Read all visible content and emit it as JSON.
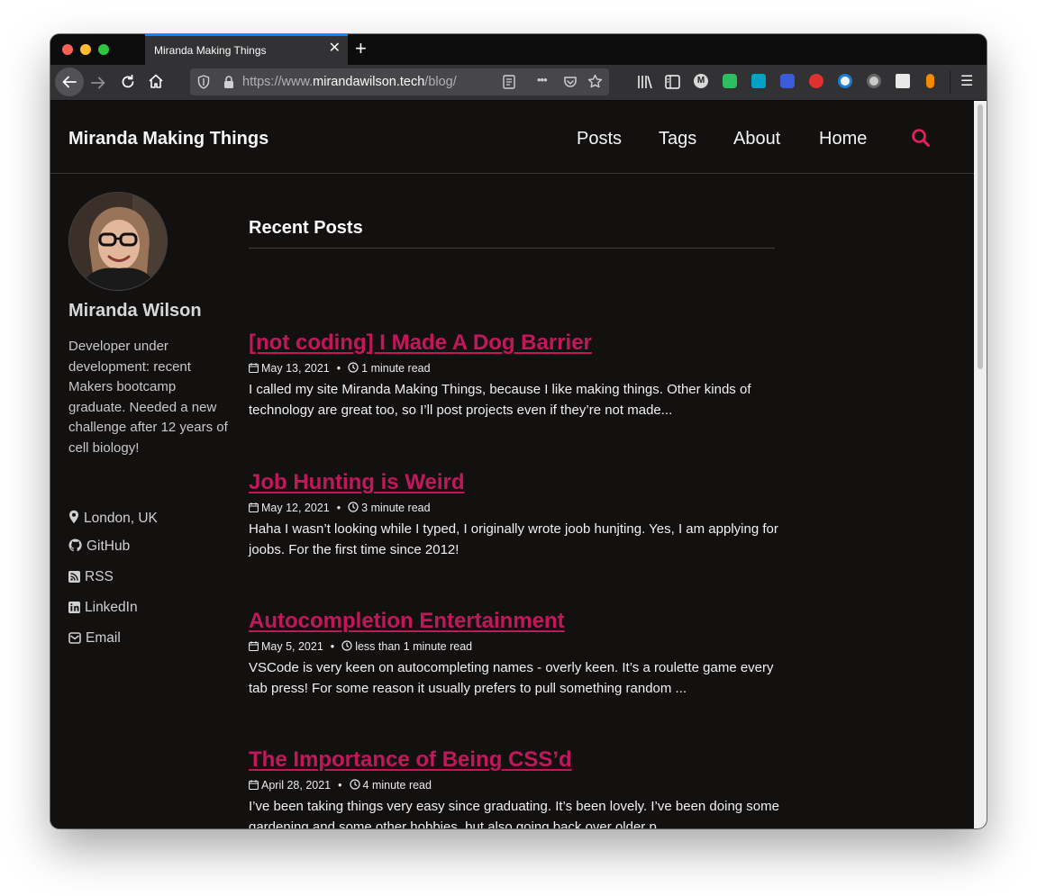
{
  "browser": {
    "tab_title": "Miranda Making Things",
    "tab_close": "✕",
    "new_tab": "+",
    "url_prefix": "https://www.",
    "url_domain": "mirandawilson.tech",
    "url_path": "/blog/",
    "page_actions": "•••",
    "menu": "☰"
  },
  "site": {
    "title": "Miranda Making Things",
    "nav": [
      "Posts",
      "Tags",
      "About",
      "Home"
    ],
    "accent_color": "#e91e63"
  },
  "author": {
    "name": "Miranda Wilson",
    "bio": "Developer under development: recent Makers bootcamp graduate. Needed a new challenge after 12 years of cell biology!",
    "links": [
      {
        "icon": "location-pin-icon",
        "label": "London, UK"
      },
      {
        "icon": "github-icon",
        "label": "GitHub"
      },
      {
        "icon": "rss-icon",
        "label": "RSS"
      },
      {
        "icon": "linkedin-icon",
        "label": "LinkedIn"
      },
      {
        "icon": "email-icon",
        "label": "Email"
      }
    ]
  },
  "main": {
    "section_title": "Recent Posts",
    "posts": [
      {
        "title": "[not coding] I Made A Dog Barrier",
        "date": "May 13, 2021",
        "read_time": "1 minute read",
        "excerpt": "I called my site Miranda Making Things, because I like making things. Other kinds of technology are great too, so I’ll post projects even if they’re not made..."
      },
      {
        "title": "Job Hunting is Weird",
        "date": "May 12, 2021",
        "read_time": "3 minute read",
        "excerpt": "Haha I wasn’t looking while I typed, I originally wrote joob hunjting. Yes, I am applying for joobs. For the first time since 2012!"
      },
      {
        "title": "Autocompletion Entertainment",
        "date": "May 5, 2021",
        "read_time": "less than 1 minute read",
        "excerpt": "VSCode is very keen on autocompleting names - overly keen. It’s a roulette game every tab press! For some reason it usually prefers to pull something random ..."
      },
      {
        "title": "The Importance of Being CSS’d",
        "date": "April 28, 2021",
        "read_time": "4 minute read",
        "excerpt": "I’ve been taking things very easy since graduating. It’s been lovely. I’ve been doing some gardening and some other hobbies, but also going back over older p..."
      }
    ]
  },
  "colors": {
    "page_bg": "#131010",
    "post_title": "#c2185b",
    "browser_chrome": "#323234"
  }
}
